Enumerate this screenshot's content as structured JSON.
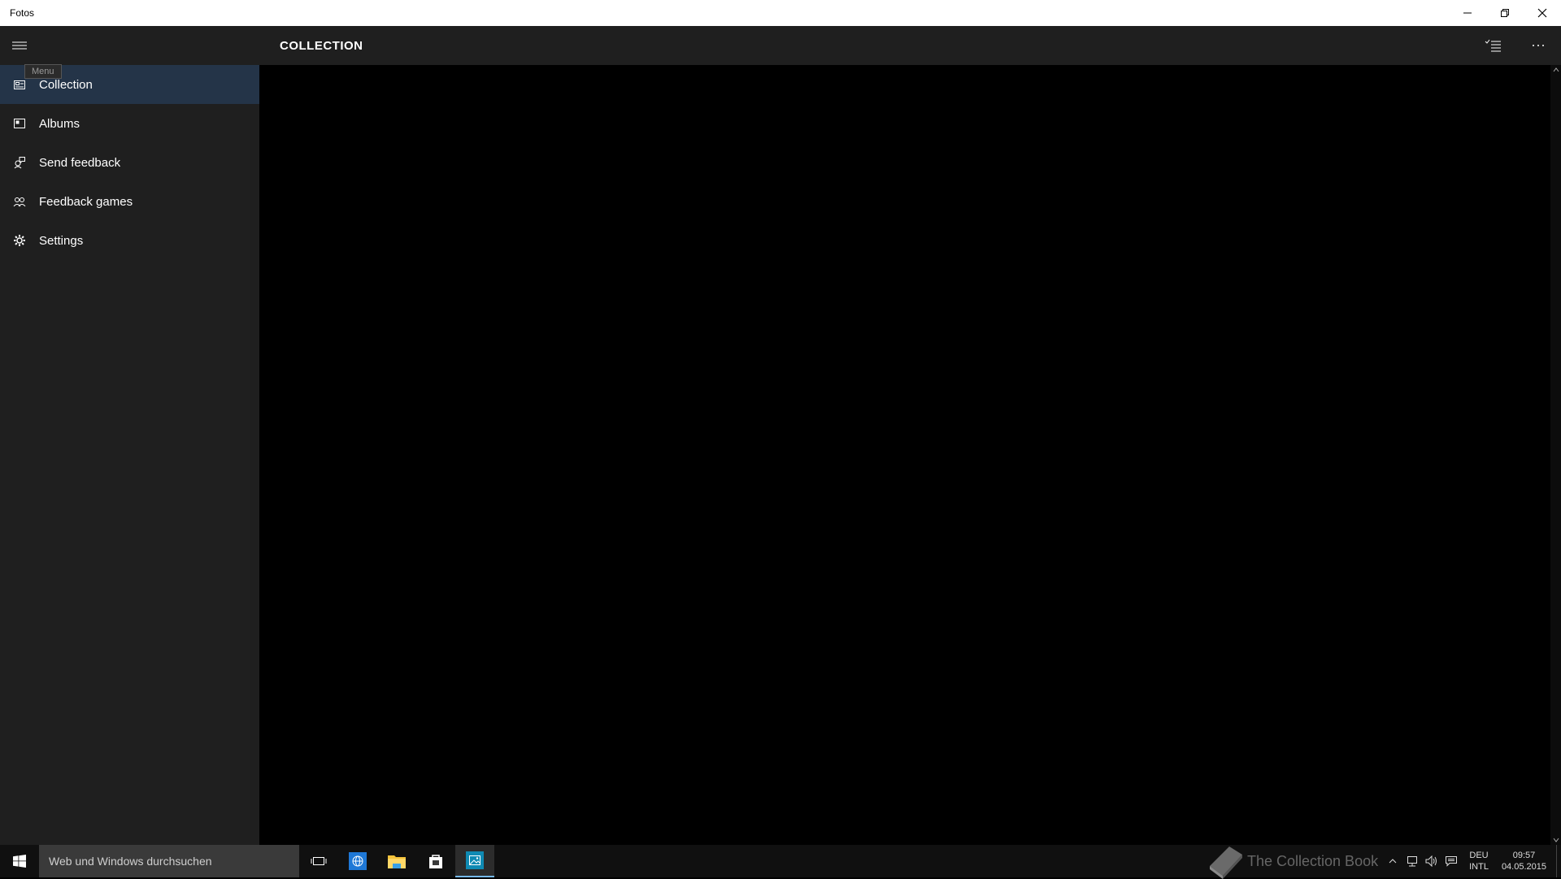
{
  "window": {
    "title": "Fotos",
    "minimize_icon": "minimize-icon",
    "restore_icon": "restore-icon",
    "close_icon": "close-icon"
  },
  "sidebar": {
    "menu_icon": "hamburger-icon",
    "tooltip": "Menu",
    "items": [
      {
        "label": "Collection",
        "icon": "collection-icon",
        "active": true
      },
      {
        "label": "Albums",
        "icon": "album-icon",
        "active": false
      },
      {
        "label": "Send feedback",
        "icon": "feedback-icon",
        "active": false
      },
      {
        "label": "Feedback games",
        "icon": "people-icon",
        "active": false
      },
      {
        "label": "Settings",
        "icon": "gear-icon",
        "active": false
      }
    ]
  },
  "header": {
    "title": "COLLECTION",
    "select_icon": "multi-select-icon",
    "more_icon": "more-icon"
  },
  "taskbar": {
    "start_icon": "windows-logo-icon",
    "search_placeholder": "Web und Windows durchsuchen",
    "apps": [
      {
        "name": "task-view-icon",
        "active": false
      },
      {
        "name": "browser-icon",
        "active": false
      },
      {
        "name": "file-explorer-icon",
        "active": false
      },
      {
        "name": "store-icon",
        "active": false
      },
      {
        "name": "photos-icon",
        "active": true
      }
    ],
    "tray": {
      "watermark": "The Collection Book",
      "lang_top": "DEU",
      "lang_bottom": "INTL",
      "time": "09:57",
      "date": "04.05.2015"
    }
  },
  "colors": {
    "accent": "#76b9ed",
    "active_nav": "#243448",
    "sidebar_bg": "#1f1f1f",
    "content_bg": "#000000"
  }
}
